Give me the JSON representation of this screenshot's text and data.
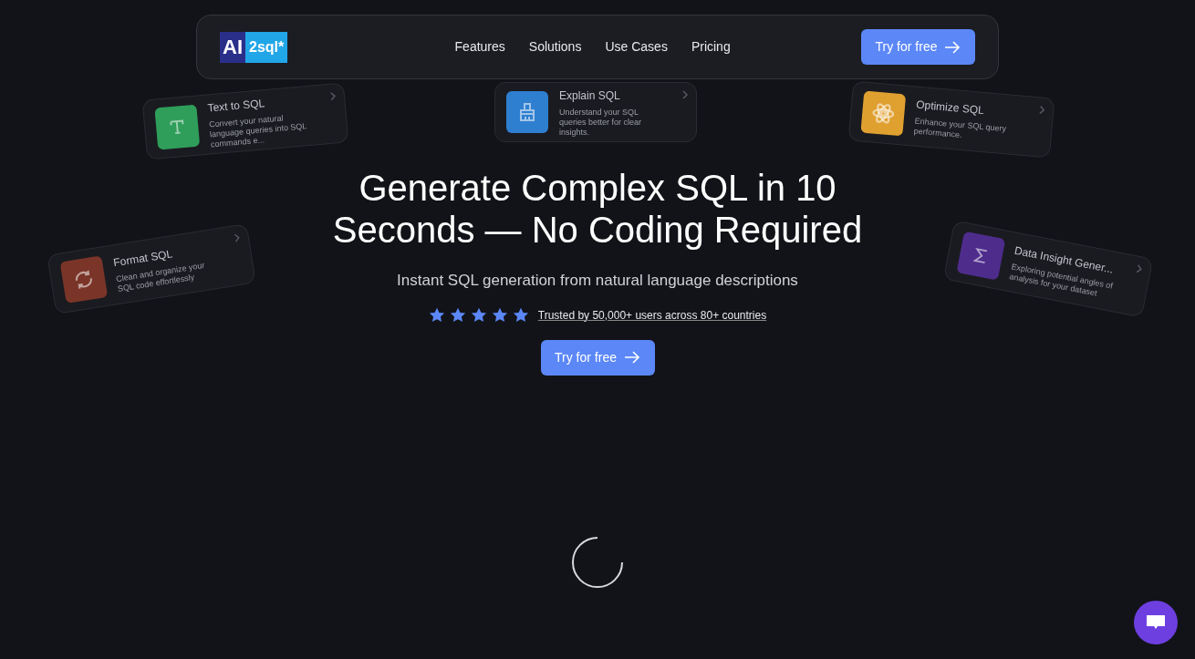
{
  "nav": {
    "logo_left": "AI",
    "logo_right": "2sql*",
    "links": [
      "Features",
      "Solutions",
      "Use Cases",
      "Pricing"
    ],
    "cta": "Try for free"
  },
  "feature_cards": [
    {
      "kind": "text",
      "color": "#2f9e5a",
      "title": "Text to SQL",
      "description": "Convert your natural language queries into SQL commands e..."
    },
    {
      "kind": "brush",
      "color": "#2f7fd0",
      "title": "Explain SQL",
      "description": "Understand your SQL queries better for clear insights."
    },
    {
      "kind": "atom",
      "color": "#e0a030",
      "title": "Optimize SQL",
      "description": "Enhance your SQL query performance."
    },
    {
      "kind": "refresh",
      "color": "#7a3528",
      "title": "Format SQL",
      "description": "Clean and organize your SQL code effortlessly"
    },
    {
      "kind": "sigma",
      "color": "#4e2c8c",
      "title": "Data Insight Gener...",
      "description": "Exploring potential angles of analysis for your dataset"
    }
  ],
  "hero": {
    "title": "Generate Complex SQL in 10 Seconds — No Coding Required",
    "subtitle": "Instant SQL generation from natural language descriptions",
    "stars": 5,
    "trust": "Trusted by 50,000+ users across 80+ countries",
    "cta": "Try for free"
  }
}
